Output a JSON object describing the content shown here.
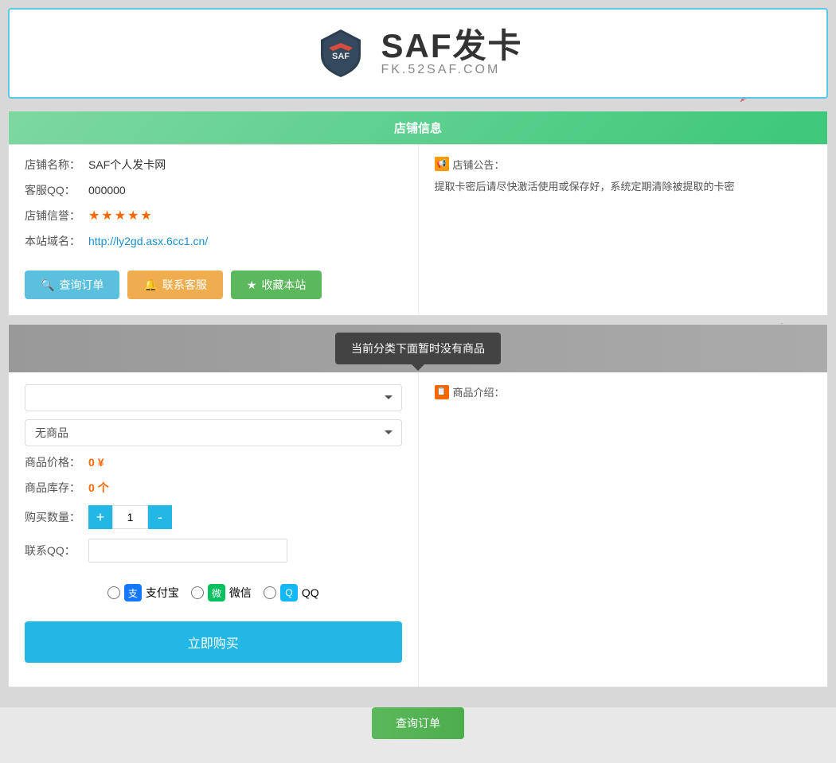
{
  "header": {
    "logo_alt": "SAF发卡",
    "logo_title": "SAF发卡",
    "logo_subtitle": "FK.52SAF.COM"
  },
  "shop_info": {
    "section_title": "店铺信息",
    "name_label": "店铺名称：",
    "name_value": "SAF个人发卡网",
    "qq_label": "客服QQ：",
    "qq_value": "000000",
    "credit_label": "店铺信誉：",
    "domain_label": "本站域名：",
    "domain_value": "http://ly2gd.asx.6cc1.cn/",
    "stars": [
      "★",
      "★",
      "★",
      "★",
      "★"
    ],
    "buttons": {
      "query": "查询订单",
      "contact": "联系客服",
      "bookmark": "收藏本站"
    },
    "announcement_label": "店铺公告：",
    "announcement_text": "提取卡密后请尽快激活使用或保存好，系统定期清除被提取的卡密"
  },
  "product": {
    "section_title": "当前分类下面暂时没有商品",
    "category_placeholder": "",
    "product_placeholder": "无商品",
    "price_label": "商品价格：",
    "price_value": "0",
    "price_unit": "¥",
    "stock_label": "商品库存：",
    "stock_value": "0",
    "stock_unit": "个",
    "qty_label": "购买数量：",
    "qty_value": "1",
    "qty_plus": "+",
    "qty_minus": "-",
    "qq_label": "联系QQ：",
    "qq_placeholder": "",
    "intro_label": "商品介绍："
  },
  "payment": {
    "options": [
      {
        "id": "alipay",
        "label": "支付宝",
        "icon": "支"
      },
      {
        "id": "wechat",
        "label": "微信",
        "icon": "微"
      },
      {
        "id": "qq",
        "label": "QQ",
        "icon": "Q"
      }
    ]
  },
  "actions": {
    "buy_now": "立即购买",
    "bottom_button": "查询订单"
  },
  "decorations": {
    "planes": [
      "✈",
      "✈",
      "✈",
      "✈",
      "✈",
      "✈",
      "✈",
      "✈",
      "✈",
      "✈",
      "✈",
      "✈"
    ]
  }
}
